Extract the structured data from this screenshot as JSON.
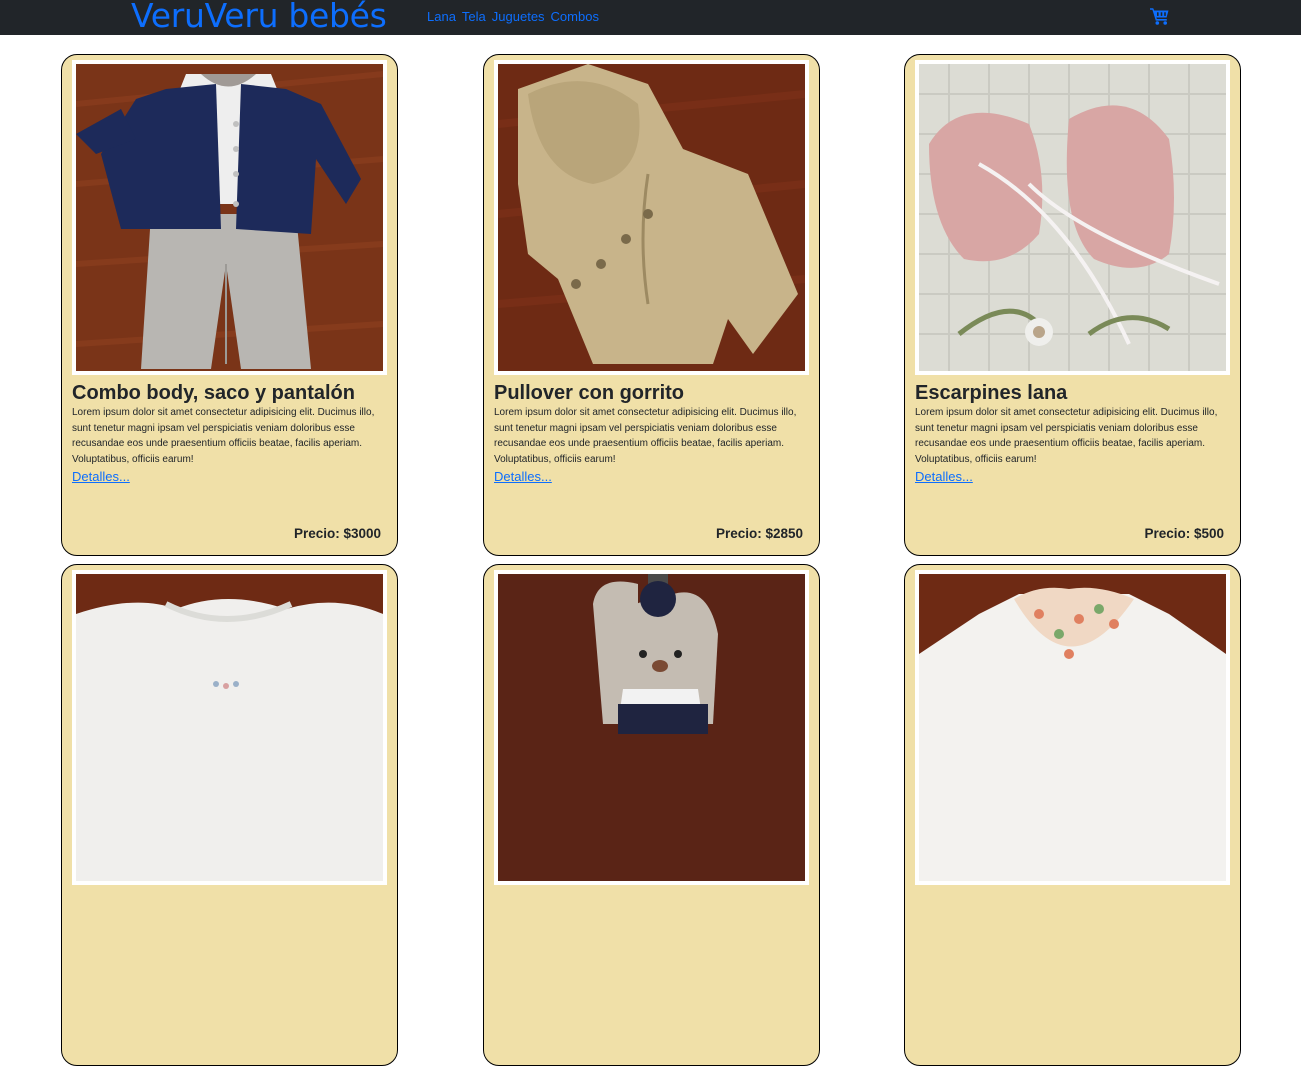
{
  "brand": "VeruVeru bebés",
  "nav": {
    "links": [
      "Lana",
      "Tela",
      "Juguetes",
      "Combos"
    ]
  },
  "cart_icon": "shopping-cart-icon",
  "colors": {
    "navbar": "#212529",
    "accent": "#0d6efd",
    "card_bg": "#f0e0a8"
  },
  "products": [
    {
      "title": "Combo body, saco y pantalón",
      "description": "Lorem ipsum dolor sit amet consectetur adipisicing elit. Ducimus illo, sunt tenetur magni ipsam vel perspiciatis veniam doloribus esse recusandae eos unde praesentium officiis beatae, facilis aperiam. Voluptatibus, officiis earum!",
      "details_label": "Detalles...",
      "price": "Precio: $3000"
    },
    {
      "title": "Pullover con gorrito",
      "description": "Lorem ipsum dolor sit amet consectetur adipisicing elit. Ducimus illo, sunt tenetur magni ipsam vel perspiciatis veniam doloribus esse recusandae eos unde praesentium officiis beatae, facilis aperiam. Voluptatibus, officiis earum!",
      "details_label": "Detalles...",
      "price": "Precio: $2850"
    },
    {
      "title": "Escarpines lana",
      "description": "Lorem ipsum dolor sit amet consectetur adipisicing elit. Ducimus illo, sunt tenetur magni ipsam vel perspiciatis veniam doloribus esse recusandae eos unde praesentium officiis beatae, facilis aperiam. Voluptatibus, officiis earum!",
      "details_label": "Detalles...",
      "price": "Precio: $500"
    }
  ]
}
